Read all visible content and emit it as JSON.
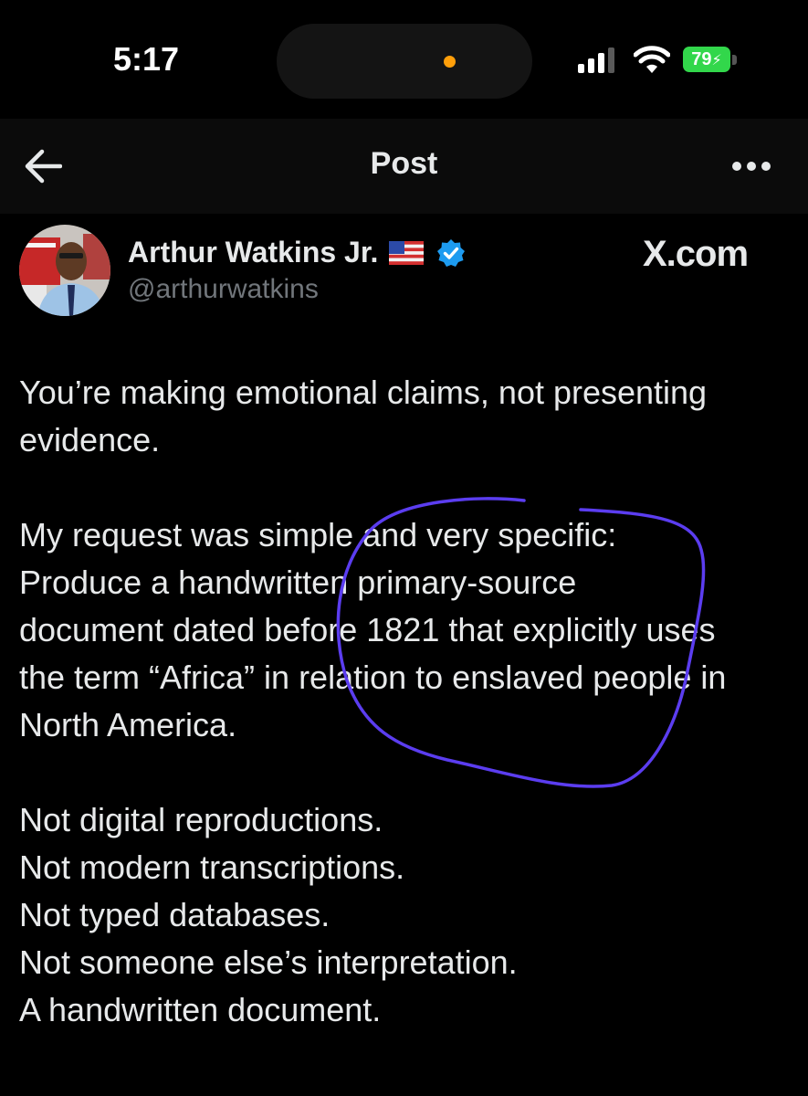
{
  "status_bar": {
    "time": "5:17",
    "battery": "79",
    "indicator_color": "#ff9f0a",
    "battery_color": "#32d74b"
  },
  "nav": {
    "title": "Post",
    "back_icon": "arrow-left-icon",
    "more_icon": "more-horizontal-icon"
  },
  "author": {
    "name": "Arthur Watkins Jr.",
    "handle": "@arthurwatkins",
    "verified_color": "#1d9bf0"
  },
  "watermark": "X.com",
  "post": {
    "paragraphs": [
      [
        "You’re making emotional claims, not presenting",
        "evidence."
      ],
      [
        "My request was simple and very specific:",
        "Produce a handwritten primary-source",
        "document dated before 1821 that explicitly uses",
        "the term “Africa” in relation to enslaved people in",
        "North America."
      ],
      [
        "Not digital reproductions.",
        "Not modern transcriptions.",
        "Not typed databases.",
        "Not someone else’s interpretation.",
        "A handwritten document."
      ]
    ]
  },
  "annotation_color": "#5b3df0"
}
